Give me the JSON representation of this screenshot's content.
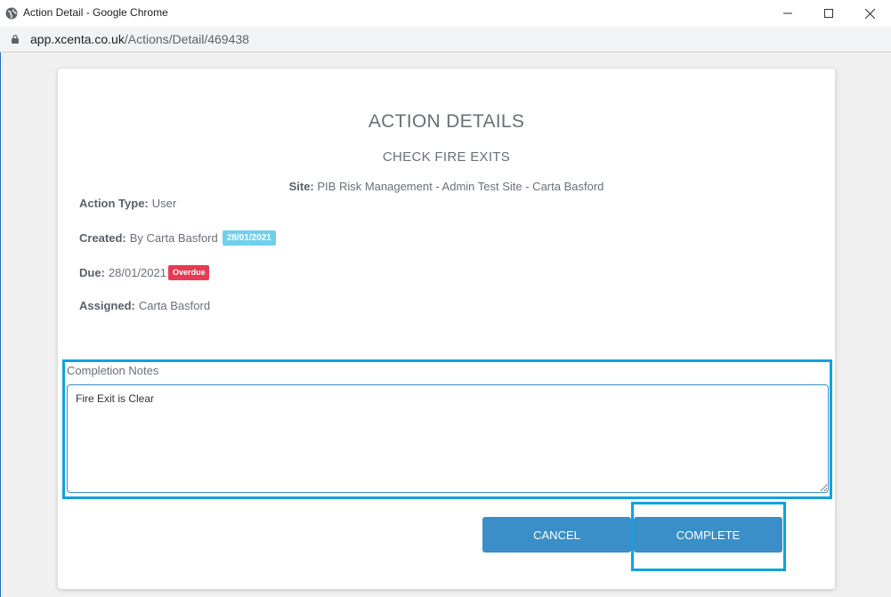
{
  "window": {
    "title": "Action Detail - Google Chrome",
    "url_host": "app.xcenta.co.uk",
    "url_path": "/Actions/Detail/469438"
  },
  "modal": {
    "heading": "ACTION DETAILS",
    "subheading": "CHECK FIRE EXITS",
    "site": {
      "label": "Site:",
      "value": " PIB Risk Management - Admin Test Site - Carta Basford"
    },
    "action_type": {
      "label": "Action Type:",
      "value": "User"
    },
    "created": {
      "label": "Created:",
      "value": "By Carta Basford",
      "date_badge": "28/01/2021"
    },
    "due": {
      "label": "Due:",
      "value": "28/01/2021",
      "status_badge": "Overdue"
    },
    "assigned": {
      "label": "Assigned:",
      "value": "Carta Basford"
    },
    "notes": {
      "label": "Completion Notes",
      "value": "Fire Exit is Clear"
    },
    "buttons": {
      "cancel": "CANCEL",
      "complete": "COMPLETE"
    }
  },
  "colors": {
    "primary_button": "#3a8fc8",
    "highlight": "#10a2df",
    "date_badge": "#6fd0ec",
    "overdue_badge": "#e83a55"
  }
}
